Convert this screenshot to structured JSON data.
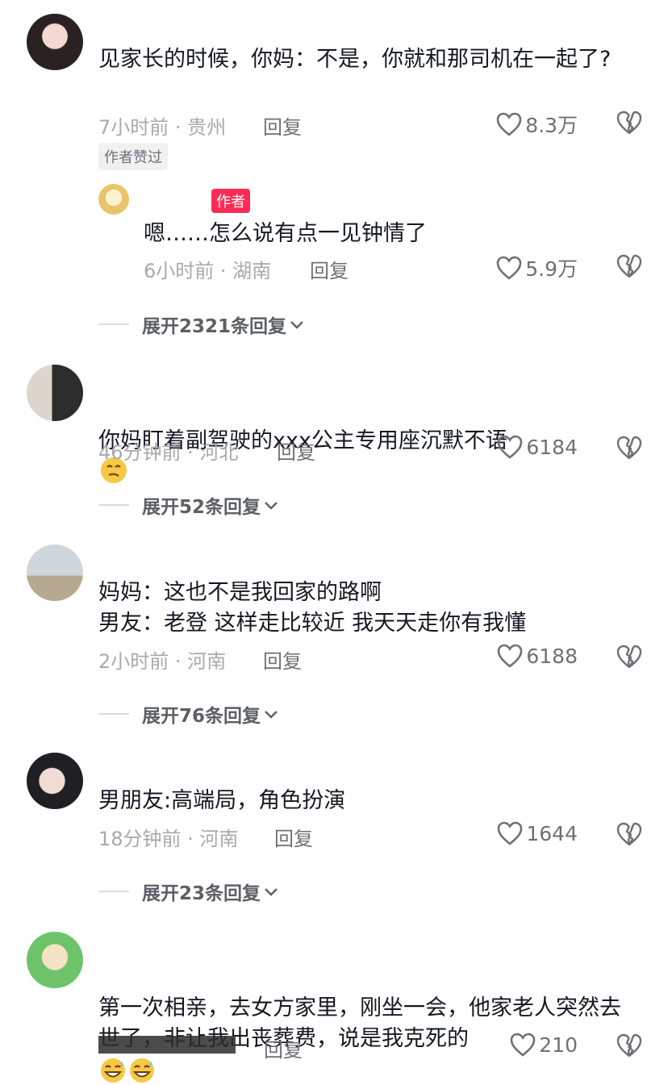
{
  "comments": [
    {
      "text": "见家长的时候，你妈：不是，你就和那司机在一起了?",
      "time_location": "7小时前 · 贵州",
      "reply_label": "回复",
      "likes": "8.3万",
      "author_liked_badge": "作者赞过",
      "reply": {
        "author_tag": "作者",
        "text": "嗯……怎么说有点一见钟情了",
        "time_location": "6小时前 · 湖南",
        "reply_label": "回复",
        "likes": "5.9万"
      },
      "expand_label": "展开2321条回复"
    },
    {
      "text": "你妈盯着副驾驶的xxx公主专用座沉默不语",
      "time_location": "46分钟前 · 河北",
      "reply_label": "回复",
      "likes": "6184",
      "expand_label": "展开52条回复"
    },
    {
      "text": "妈妈：这也不是我回家的路啊\n男友：老登 这样走比较近 我天天走你有我懂",
      "time_location": "2小时前 · 河南",
      "reply_label": "回复",
      "likes": "6188",
      "expand_label": "展开76条回复"
    },
    {
      "text": "男朋友:高端局，角色扮演",
      "time_location": "18分钟前 · 河南",
      "reply_label": "回复",
      "likes": "1644",
      "expand_label": "展开23条回复"
    },
    {
      "text": "第一次相亲，去女方家里，刚坐一会，他家老人突然去世了，非让我出丧葬费，说是我克死的",
      "reply_label": "回复",
      "likes": "210"
    }
  ],
  "icons": {
    "like": "heart-outline-icon",
    "dislike": "broken-heart-icon",
    "expand": "chevron-down-icon"
  },
  "colors": {
    "author_tag": "#fe2c55",
    "text": "#161823",
    "meta": "#a8a9ad"
  }
}
